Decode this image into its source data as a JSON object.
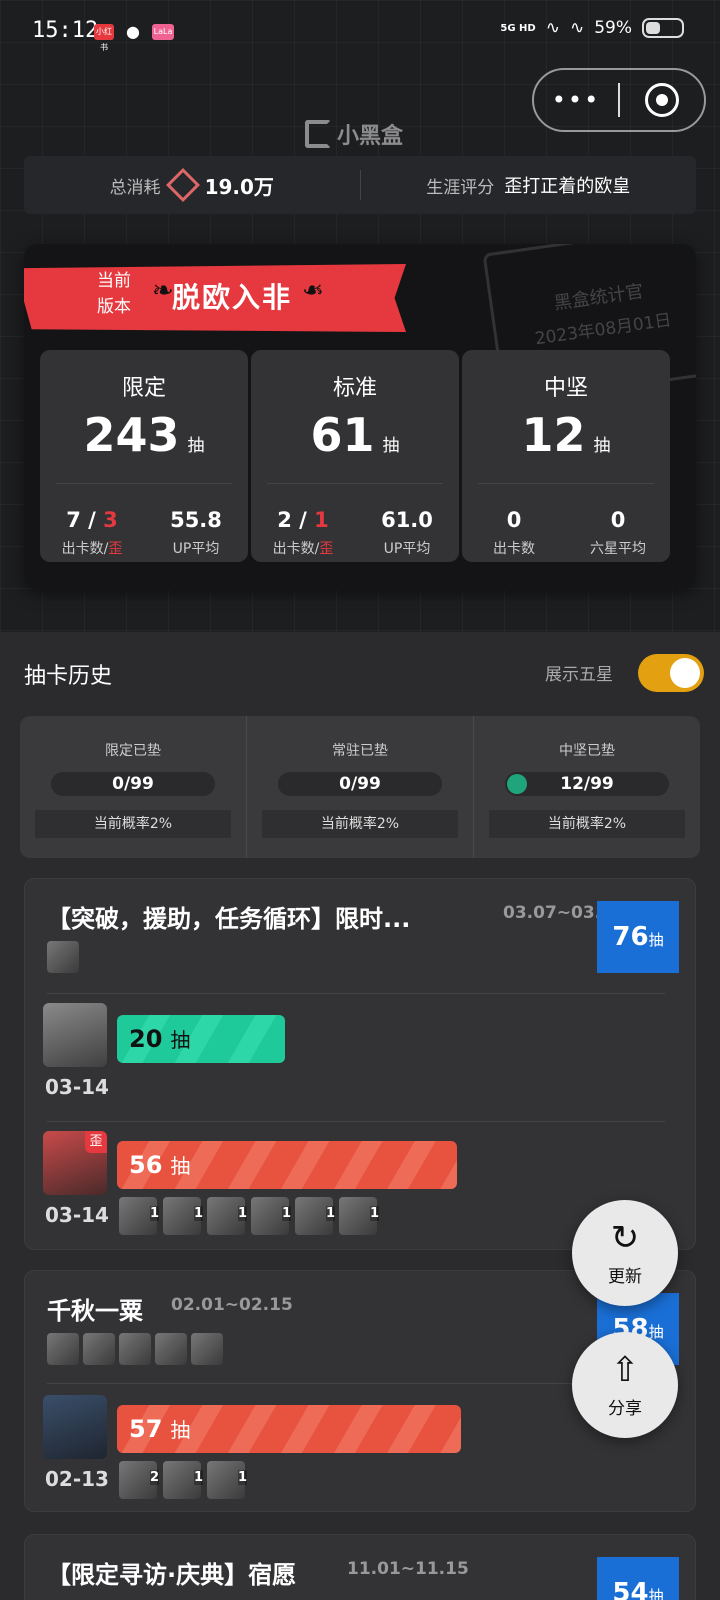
{
  "status": {
    "time": "15:12",
    "network": "5G HD",
    "battery": "59%",
    "app_icons": [
      "小红书",
      "QQ",
      "LaLa"
    ]
  },
  "header": {
    "more_glyph": "•••",
    "app_name": "小黑盒"
  },
  "summary": {
    "spend_label": "总消耗",
    "spend_value": "19.0万",
    "rating_label": "生涯评分",
    "rating_value": "歪打正着的欧皇"
  },
  "badge": {
    "sub": "当前\n版本",
    "title": "脱欧入非"
  },
  "stamp": {
    "title": "黑盒统计官",
    "date": "2023年08月01日"
  },
  "stats": [
    {
      "name": "限定",
      "count": "243",
      "unit": "抽",
      "got": "7",
      "off": "3",
      "avg": "55.8",
      "got_label": "出卡数",
      "slash": " / ",
      "off_label": "歪",
      "avg_label": "UP平均"
    },
    {
      "name": "标准",
      "count": "61",
      "unit": "抽",
      "got": "2",
      "off": "1",
      "avg": "61.0",
      "got_label": "出卡数",
      "slash": " / ",
      "off_label": "歪",
      "avg_label": "UP平均"
    },
    {
      "name": "中坚",
      "count": "12",
      "unit": "抽",
      "got": "0",
      "off": "",
      "avg": "0",
      "got_label": "出卡数",
      "slash": "",
      "off_label": "",
      "avg_label": "六星平均"
    }
  ],
  "history": {
    "title": "抽卡历史",
    "toggle_label": "展示五星",
    "toggle_on": true
  },
  "pity": [
    {
      "label": "限定已垫",
      "value": "0/99",
      "rate": "当前概率2%",
      "progress": 0
    },
    {
      "label": "常驻已垫",
      "value": "0/99",
      "rate": "当前概率2%",
      "progress": 0
    },
    {
      "label": "中坚已垫",
      "value": "12/99",
      "rate": "当前概率2%",
      "progress": 0.12
    }
  ],
  "pools": [
    {
      "title": "【突破，援助，任务循环】限时...",
      "date": "03.07~03....",
      "total": "76",
      "unit": "抽",
      "pulls": [
        {
          "date": "03-14",
          "count": "20",
          "unit": "抽",
          "color": "green",
          "off": false,
          "five_stars": []
        },
        {
          "date": "03-14",
          "count": "56",
          "unit": "抽",
          "color": "red",
          "off": true,
          "off_label": "歪",
          "five_stars": [
            "1",
            "1",
            "1",
            "1",
            "1",
            "1"
          ]
        }
      ]
    },
    {
      "title": "千秋一粟",
      "date": "02.01~02.15",
      "total": "58",
      "unit": "抽",
      "pulls": [
        {
          "date": "02-13",
          "count": "57",
          "unit": "抽",
          "color": "red",
          "off": false,
          "five_stars": [
            "2",
            "1",
            "1"
          ]
        }
      ]
    },
    {
      "title": "【限定寻访·庆典】宿愿",
      "date": "11.01~11.15",
      "total": "54",
      "unit": "抽",
      "pulls": []
    }
  ],
  "fabs": {
    "refresh": "更新",
    "share": "分享"
  },
  "colors": {
    "accent_red": "#e5393f",
    "toggle": "#e3a111",
    "total_blue": "#1a6fd6",
    "green_bar": "#1fca9a"
  }
}
